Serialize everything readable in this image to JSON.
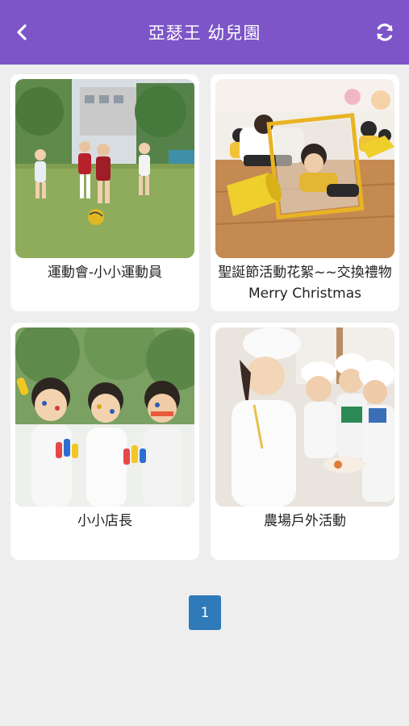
{
  "header": {
    "title": "亞瑟王 幼兒園",
    "back_icon": "chevron-left-icon",
    "refresh_icon": "refresh-icon",
    "background": "#7d55c8"
  },
  "albums": [
    {
      "title": "運動會-小小運動員",
      "photo_subject": "sports-day-soccer"
    },
    {
      "title": "聖誕節活動花絮~~交換禮物 Merry Christmas",
      "photo_subject": "mirror-play-classroom"
    },
    {
      "title": "小小店長",
      "photo_subject": "face-painted-children"
    },
    {
      "title": "農場戶外活動",
      "photo_subject": "children-in-chef-hats"
    }
  ],
  "pagination": {
    "current_page": "1",
    "active_color": "#2f7ab9"
  }
}
